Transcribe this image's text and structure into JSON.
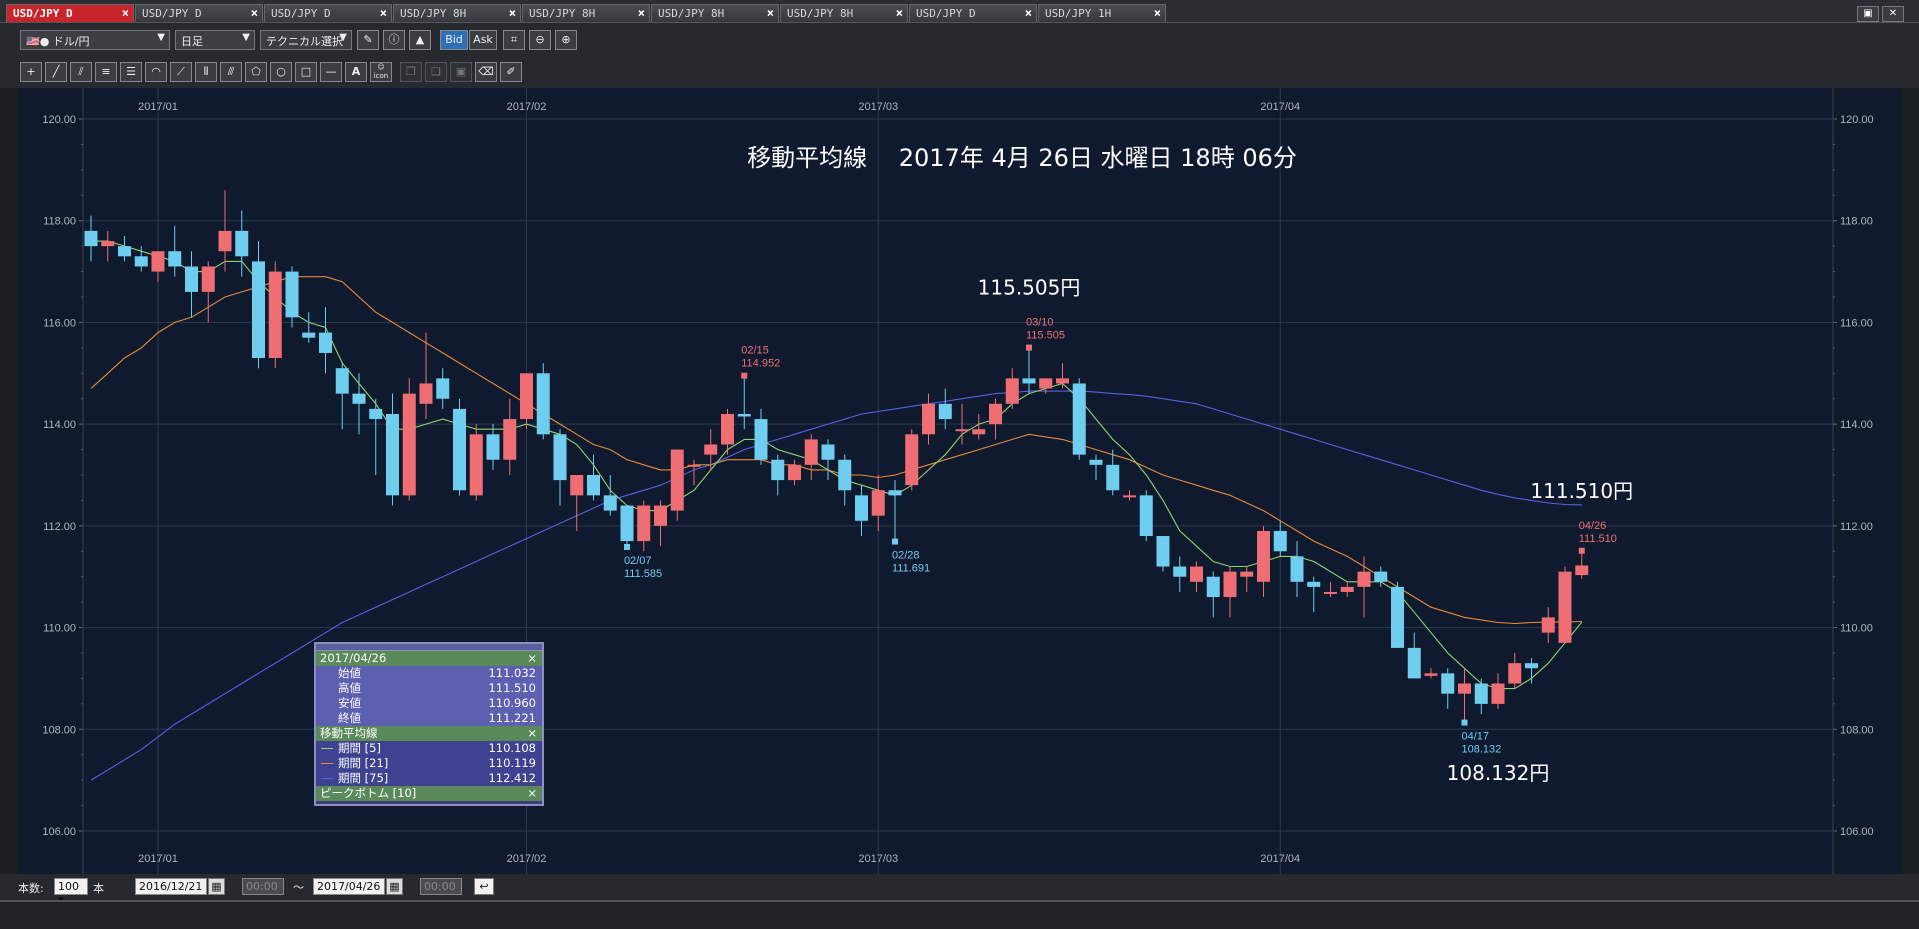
{
  "tabs": [
    {
      "label": "USD/JPY D",
      "active": true
    },
    {
      "label": "USD/JPY D"
    },
    {
      "label": "USD/JPY D"
    },
    {
      "label": "USD/JPY 8H"
    },
    {
      "label": "USD/JPY 8H"
    },
    {
      "label": "USD/JPY 8H"
    },
    {
      "label": "USD/JPY 8H"
    },
    {
      "label": "USD/JPY D"
    },
    {
      "label": "USD/JPY 1H"
    }
  ],
  "toolbar": {
    "symbol": "ドル/円",
    "period": "日足",
    "technical": "テクニカル選択",
    "bid": "Bid",
    "ask": "Ask",
    "text_tool": "A",
    "icon_tool": "icon"
  },
  "bottom": {
    "count_label": "本数:",
    "count_value": "100",
    "count_unit": "本",
    "start_date": "2016/12/21",
    "start_time": "00:00",
    "tilde": "〜",
    "end_date": "2017/04/26",
    "end_time": "00:00"
  },
  "data_window": {
    "date": "2017/04/26",
    "rows": [
      {
        "label": "始値",
        "value": "111.032"
      },
      {
        "label": "高値",
        "value": "111.510"
      },
      {
        "label": "安値",
        "value": "110.960"
      },
      {
        "label": "終値",
        "value": "111.221"
      }
    ],
    "ma_title": "移動平均線",
    "ma_rows": [
      {
        "label": "期間 [5]",
        "value": "110.108",
        "color": "#8fd46e"
      },
      {
        "label": "期間 [21]",
        "value": "110.119",
        "color": "#e88a3a"
      },
      {
        "label": "期間 [75]",
        "value": "112.412",
        "color": "#5a60e0"
      }
    ],
    "peak_title": "ピークボトム [10]",
    "close_glyph": "×"
  },
  "chart_data": {
    "type": "candlestick",
    "title": "移動平均線　 2017年 4月 26日 水曜日 18時 06分",
    "yticks": [
      "120.00",
      "118.00",
      "116.00",
      "114.00",
      "112.00",
      "110.00",
      "108.00",
      "106.00"
    ],
    "ylim": [
      106,
      120
    ],
    "x_month_labels": [
      {
        "label": "2017/01",
        "index": 4
      },
      {
        "label": "2017/02",
        "index": 26
      },
      {
        "label": "2017/03",
        "index": 47
      },
      {
        "label": "2017/04",
        "index": 71
      }
    ],
    "up_color": "#ee6e73",
    "down_color": "#6fcdf0",
    "candles": [
      [
        117.8,
        118.1,
        117.2,
        117.5
      ],
      [
        117.5,
        117.8,
        117.2,
        117.6
      ],
      [
        117.5,
        117.7,
        117.2,
        117.3
      ],
      [
        117.3,
        117.5,
        117.0,
        117.1
      ],
      [
        117.0,
        117.4,
        116.8,
        117.4
      ],
      [
        117.4,
        117.9,
        116.9,
        117.1
      ],
      [
        117.1,
        117.4,
        116.1,
        116.6
      ],
      [
        116.6,
        117.2,
        116.0,
        117.1
      ],
      [
        117.4,
        118.6,
        117.0,
        117.8
      ],
      [
        117.8,
        118.2,
        116.9,
        117.3
      ],
      [
        117.2,
        117.6,
        115.1,
        115.3
      ],
      [
        115.3,
        117.2,
        115.1,
        117.0
      ],
      [
        117.0,
        117.1,
        115.9,
        116.1
      ],
      [
        115.8,
        116.2,
        115.6,
        115.7
      ],
      [
        115.8,
        116.3,
        115.0,
        115.4
      ],
      [
        115.1,
        115.2,
        113.9,
        114.6
      ],
      [
        114.6,
        115.0,
        113.8,
        114.4
      ],
      [
        114.3,
        114.5,
        113.0,
        114.1
      ],
      [
        114.2,
        114.6,
        112.4,
        112.6
      ],
      [
        112.6,
        114.9,
        112.5,
        114.6
      ],
      [
        114.4,
        115.8,
        114.1,
        114.8
      ],
      [
        114.9,
        115.1,
        114.3,
        114.5
      ],
      [
        114.3,
        114.5,
        112.6,
        112.7
      ],
      [
        112.6,
        114.0,
        112.5,
        113.8
      ],
      [
        113.8,
        114.0,
        113.1,
        113.3
      ],
      [
        113.3,
        114.5,
        113.0,
        114.1
      ],
      [
        114.1,
        115.0,
        113.9,
        115.0
      ],
      [
        115.0,
        115.2,
        113.7,
        113.8
      ],
      [
        113.8,
        113.9,
        112.4,
        112.9
      ],
      [
        112.6,
        113.0,
        111.9,
        113.0
      ],
      [
        113.0,
        113.4,
        112.5,
        112.6
      ],
      [
        112.6,
        113.0,
        112.2,
        112.3
      ],
      [
        112.4,
        112.4,
        111.6,
        111.7
      ],
      [
        111.7,
        112.5,
        111.5,
        112.4
      ],
      [
        112.0,
        112.5,
        111.6,
        112.4
      ],
      [
        112.3,
        113.5,
        112.1,
        113.5
      ],
      [
        113.2,
        113.3,
        112.8,
        113.2
      ],
      [
        113.4,
        113.9,
        113.1,
        113.6
      ],
      [
        113.6,
        114.3,
        113.4,
        114.2
      ],
      [
        114.2,
        114.95,
        113.9,
        114.15
      ],
      [
        114.1,
        114.3,
        113.2,
        113.3
      ],
      [
        113.3,
        113.4,
        112.6,
        112.9
      ],
      [
        112.9,
        113.3,
        112.8,
        113.2
      ],
      [
        113.2,
        113.8,
        112.9,
        113.7
      ],
      [
        113.6,
        113.7,
        112.9,
        113.3
      ],
      [
        113.3,
        113.4,
        112.4,
        112.7
      ],
      [
        112.6,
        112.8,
        111.8,
        112.1
      ],
      [
        112.2,
        113.0,
        111.9,
        112.7
      ],
      [
        112.7,
        112.9,
        111.69,
        112.6
      ],
      [
        112.8,
        113.9,
        112.7,
        113.8
      ],
      [
        113.8,
        114.6,
        113.6,
        114.4
      ],
      [
        114.4,
        114.7,
        113.9,
        114.1
      ],
      [
        113.9,
        114.4,
        113.6,
        113.9
      ],
      [
        113.8,
        114.2,
        113.7,
        113.9
      ],
      [
        114.0,
        114.5,
        113.7,
        114.4
      ],
      [
        114.4,
        115.1,
        114.3,
        114.9
      ],
      [
        114.9,
        115.505,
        114.6,
        114.8
      ],
      [
        114.7,
        114.9,
        114.6,
        114.9
      ],
      [
        114.8,
        115.2,
        114.7,
        114.9
      ],
      [
        114.8,
        114.9,
        113.3,
        113.4
      ],
      [
        113.3,
        113.4,
        112.9,
        113.2
      ],
      [
        113.2,
        113.5,
        112.6,
        112.7
      ],
      [
        112.6,
        112.7,
        112.5,
        112.6
      ],
      [
        112.6,
        112.7,
        111.7,
        111.8
      ],
      [
        111.8,
        111.8,
        111.1,
        111.2
      ],
      [
        111.2,
        111.4,
        110.7,
        111.0
      ],
      [
        110.9,
        111.3,
        110.7,
        111.2
      ],
      [
        111.0,
        111.1,
        110.2,
        110.6
      ],
      [
        110.6,
        111.2,
        110.2,
        111.1
      ],
      [
        111.0,
        111.2,
        110.7,
        111.1
      ],
      [
        110.9,
        112.0,
        110.6,
        111.9
      ],
      [
        111.9,
        112.1,
        111.4,
        111.5
      ],
      [
        111.4,
        111.7,
        110.6,
        110.9
      ],
      [
        110.9,
        111.0,
        110.3,
        110.8
      ],
      [
        110.7,
        110.9,
        110.6,
        110.7
      ],
      [
        110.7,
        110.9,
        110.6,
        110.8
      ],
      [
        110.8,
        111.4,
        110.2,
        111.1
      ],
      [
        111.1,
        111.2,
        110.8,
        110.9
      ],
      [
        110.8,
        110.9,
        109.6,
        109.6
      ],
      [
        109.6,
        109.9,
        109.0,
        109.0
      ],
      [
        109.05,
        109.2,
        109.0,
        109.1
      ],
      [
        109.1,
        109.2,
        108.4,
        108.7
      ],
      [
        108.7,
        109.2,
        108.132,
        108.9
      ],
      [
        108.9,
        109.0,
        108.3,
        108.5
      ],
      [
        108.5,
        109.1,
        108.4,
        108.9
      ],
      [
        108.9,
        109.5,
        108.8,
        109.3
      ],
      [
        109.3,
        109.4,
        108.9,
        109.2
      ],
      [
        109.9,
        110.4,
        109.7,
        110.2
      ],
      [
        109.7,
        111.2,
        109.7,
        111.1
      ],
      [
        111.032,
        111.51,
        110.96,
        111.221
      ]
    ],
    "ma5": [
      117.6,
      117.6,
      117.5,
      117.4,
      117.3,
      117.2,
      117.0,
      117.0,
      117.2,
      117.2,
      116.8,
      116.5,
      116.2,
      116.0,
      115.9,
      115.2,
      114.8,
      114.4,
      113.9,
      113.9,
      114.0,
      114.1,
      114.0,
      113.9,
      113.9,
      113.9,
      114.0,
      113.9,
      113.8,
      113.6,
      113.2,
      112.7,
      112.4,
      112.3,
      112.3,
      112.5,
      112.7,
      113.1,
      113.5,
      113.7,
      113.7,
      113.5,
      113.4,
      113.3,
      113.1,
      112.9,
      112.8,
      112.7,
      112.6,
      112.8,
      113.1,
      113.4,
      113.8,
      114.0,
      114.1,
      114.4,
      114.6,
      114.7,
      114.8,
      114.5,
      114.1,
      113.7,
      113.4,
      113.0,
      112.5,
      111.9,
      111.6,
      111.3,
      111.2,
      111.2,
      111.3,
      111.4,
      111.4,
      111.3,
      111.1,
      110.9,
      110.9,
      110.9,
      110.7,
      110.3,
      109.9,
      109.5,
      109.2,
      108.9,
      108.8,
      108.8,
      109.0,
      109.3,
      109.7,
      110.108
    ],
    "ma21": [
      114.7,
      115.0,
      115.3,
      115.5,
      115.8,
      116.0,
      116.1,
      116.3,
      116.5,
      116.6,
      116.7,
      116.8,
      116.9,
      116.9,
      116.9,
      116.8,
      116.5,
      116.2,
      116.0,
      115.8,
      115.6,
      115.4,
      115.2,
      115.0,
      114.8,
      114.6,
      114.4,
      114.2,
      114.0,
      113.8,
      113.6,
      113.5,
      113.3,
      113.2,
      113.1,
      113.1,
      113.2,
      113.2,
      113.3,
      113.3,
      113.3,
      113.2,
      113.2,
      113.1,
      113.1,
      113.0,
      113.0,
      112.95,
      113.0,
      113.1,
      113.2,
      113.3,
      113.4,
      113.5,
      113.6,
      113.7,
      113.8,
      113.75,
      113.7,
      113.6,
      113.5,
      113.4,
      113.3,
      113.15,
      113.0,
      112.9,
      112.8,
      112.7,
      112.6,
      112.45,
      112.3,
      112.1,
      111.9,
      111.7,
      111.55,
      111.4,
      111.2,
      111.0,
      110.8,
      110.6,
      110.4,
      110.3,
      110.2,
      110.15,
      110.1,
      110.08,
      110.1,
      110.108,
      110.11,
      110.119
    ],
    "ma75": [
      107.0,
      107.2,
      107.4,
      107.6,
      107.85,
      108.1,
      108.3,
      108.5,
      108.7,
      108.9,
      109.1,
      109.3,
      109.5,
      109.7,
      109.9,
      110.1,
      110.25,
      110.4,
      110.55,
      110.7,
      110.85,
      111.0,
      111.15,
      111.3,
      111.45,
      111.6,
      111.75,
      111.9,
      112.05,
      112.2,
      112.35,
      112.5,
      112.6,
      112.7,
      112.8,
      112.95,
      113.1,
      113.2,
      113.35,
      113.5,
      113.6,
      113.7,
      113.8,
      113.9,
      114.0,
      114.1,
      114.2,
      114.25,
      114.3,
      114.35,
      114.4,
      114.45,
      114.5,
      114.55,
      114.6,
      114.62,
      114.65,
      114.65,
      114.65,
      114.65,
      114.63,
      114.6,
      114.58,
      114.55,
      114.5,
      114.45,
      114.4,
      114.3,
      114.2,
      114.1,
      114.0,
      113.9,
      113.8,
      113.7,
      113.6,
      113.5,
      113.4,
      113.3,
      113.2,
      113.1,
      113.0,
      112.9,
      112.8,
      112.7,
      112.62,
      112.55,
      112.5,
      112.45,
      112.42,
      112.412
    ],
    "peaks": [
      {
        "index": 32,
        "date": "02/07",
        "price": "111.585",
        "type": "bottom"
      },
      {
        "index": 39,
        "date": "02/15",
        "price": "114.952",
        "type": "peak"
      },
      {
        "index": 48,
        "date": "02/28",
        "price": "111.691",
        "type": "bottom"
      },
      {
        "index": 56,
        "date": "03/10",
        "price": "115.505",
        "type": "peak"
      },
      {
        "index": 82,
        "date": "04/17",
        "price": "108.132",
        "type": "bottom"
      },
      {
        "index": 89,
        "date": "04/26",
        "price": "111.510",
        "type": "peak"
      }
    ],
    "annotations": [
      {
        "text": "115.505円",
        "index": 56,
        "y": 116.55
      },
      {
        "text": "111.510円",
        "index": 89,
        "y": 112.55
      },
      {
        "text": "108.132円",
        "index": 84,
        "y": 107.0
      }
    ]
  }
}
